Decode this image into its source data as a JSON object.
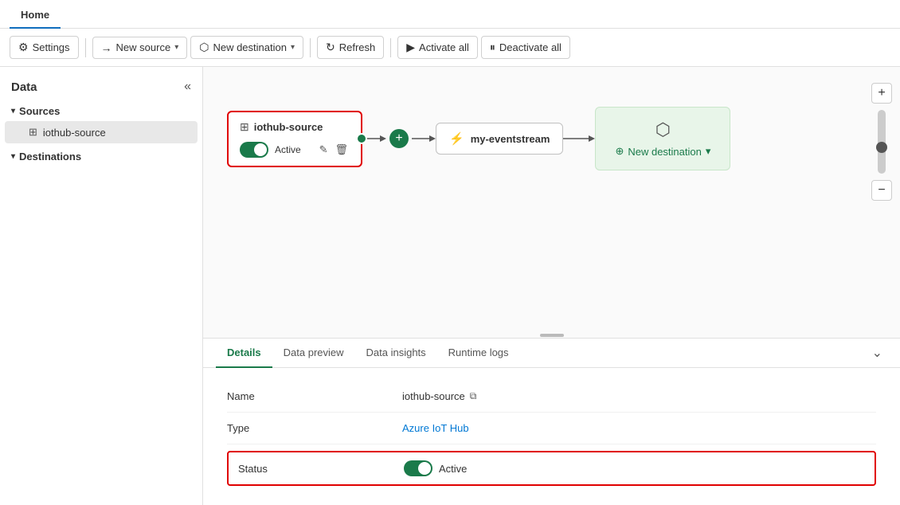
{
  "tabs": {
    "home": "Home"
  },
  "toolbar": {
    "settings_label": "Settings",
    "new_source_label": "New source",
    "new_destination_label": "New destination",
    "refresh_label": "Refresh",
    "activate_all_label": "Activate all",
    "deactivate_all_label": "Deactivate all"
  },
  "sidebar": {
    "title": "Data",
    "collapse_icon": "«",
    "sources_label": "Sources",
    "destinations_label": "Destinations",
    "source_item": "iothub-source"
  },
  "canvas": {
    "source_node": {
      "title": "iothub-source",
      "status": "Active"
    },
    "eventstream_node": {
      "title": "my-eventstream"
    },
    "destination": {
      "new_label": "New destination"
    }
  },
  "bottom_panel": {
    "tabs": [
      "Details",
      "Data preview",
      "Data insights",
      "Runtime logs"
    ],
    "active_tab": "Details"
  },
  "details": {
    "name_label": "Name",
    "name_value": "iothub-source",
    "type_label": "Type",
    "type_value": "Azure IoT Hub",
    "status_label": "Status",
    "status_value": "Active"
  }
}
